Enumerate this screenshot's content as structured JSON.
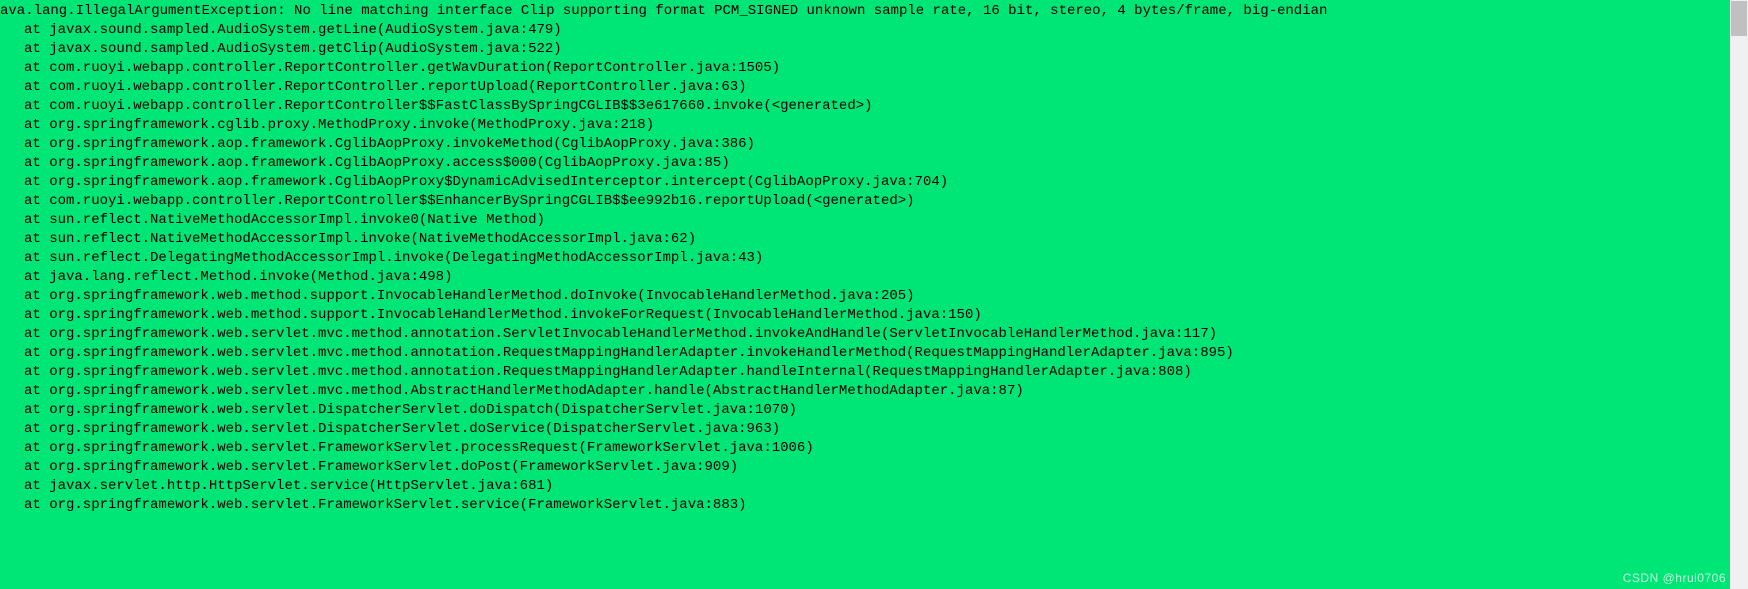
{
  "exception": {
    "message": "ava.lang.IllegalArgumentException: No line matching interface Clip supporting format PCM_SIGNED unknown sample rate, 16 bit, stereo, 4 bytes/frame, big-endian"
  },
  "stack": [
    "at javax.sound.sampled.AudioSystem.getLine(AudioSystem.java:479)",
    "at javax.sound.sampled.AudioSystem.getClip(AudioSystem.java:522)",
    "at com.ruoyi.webapp.controller.ReportController.getWavDuration(ReportController.java:1505)",
    "at com.ruoyi.webapp.controller.ReportController.reportUpload(ReportController.java:63)",
    "at com.ruoyi.webapp.controller.ReportController$$FastClassBySpringCGLIB$$3e617660.invoke(<generated>)",
    "at org.springframework.cglib.proxy.MethodProxy.invoke(MethodProxy.java:218)",
    "at org.springframework.aop.framework.CglibAopProxy.invokeMethod(CglibAopProxy.java:386)",
    "at org.springframework.aop.framework.CglibAopProxy.access$000(CglibAopProxy.java:85)",
    "at org.springframework.aop.framework.CglibAopProxy$DynamicAdvisedInterceptor.intercept(CglibAopProxy.java:704)",
    "at com.ruoyi.webapp.controller.ReportController$$EnhancerBySpringCGLIB$$ee992b16.reportUpload(<generated>)",
    "at sun.reflect.NativeMethodAccessorImpl.invoke0(Native Method)",
    "at sun.reflect.NativeMethodAccessorImpl.invoke(NativeMethodAccessorImpl.java:62)",
    "at sun.reflect.DelegatingMethodAccessorImpl.invoke(DelegatingMethodAccessorImpl.java:43)",
    "at java.lang.reflect.Method.invoke(Method.java:498)",
    "at org.springframework.web.method.support.InvocableHandlerMethod.doInvoke(InvocableHandlerMethod.java:205)",
    "at org.springframework.web.method.support.InvocableHandlerMethod.invokeForRequest(InvocableHandlerMethod.java:150)",
    "at org.springframework.web.servlet.mvc.method.annotation.ServletInvocableHandlerMethod.invokeAndHandle(ServletInvocableHandlerMethod.java:117)",
    "at org.springframework.web.servlet.mvc.method.annotation.RequestMappingHandlerAdapter.invokeHandlerMethod(RequestMappingHandlerAdapter.java:895)",
    "at org.springframework.web.servlet.mvc.method.annotation.RequestMappingHandlerAdapter.handleInternal(RequestMappingHandlerAdapter.java:808)",
    "at org.springframework.web.servlet.mvc.method.AbstractHandlerMethodAdapter.handle(AbstractHandlerMethodAdapter.java:87)",
    "at org.springframework.web.servlet.DispatcherServlet.doDispatch(DispatcherServlet.java:1070)",
    "at org.springframework.web.servlet.DispatcherServlet.doService(DispatcherServlet.java:963)",
    "at org.springframework.web.servlet.FrameworkServlet.processRequest(FrameworkServlet.java:1006)",
    "at org.springframework.web.servlet.FrameworkServlet.doPost(FrameworkServlet.java:909)",
    "at javax.servlet.http.HttpServlet.service(HttpServlet.java:681)",
    "at org.springframework.web.servlet.FrameworkServlet.service(FrameworkServlet.java:883)"
  ],
  "watermark": "CSDN @hrui0706"
}
